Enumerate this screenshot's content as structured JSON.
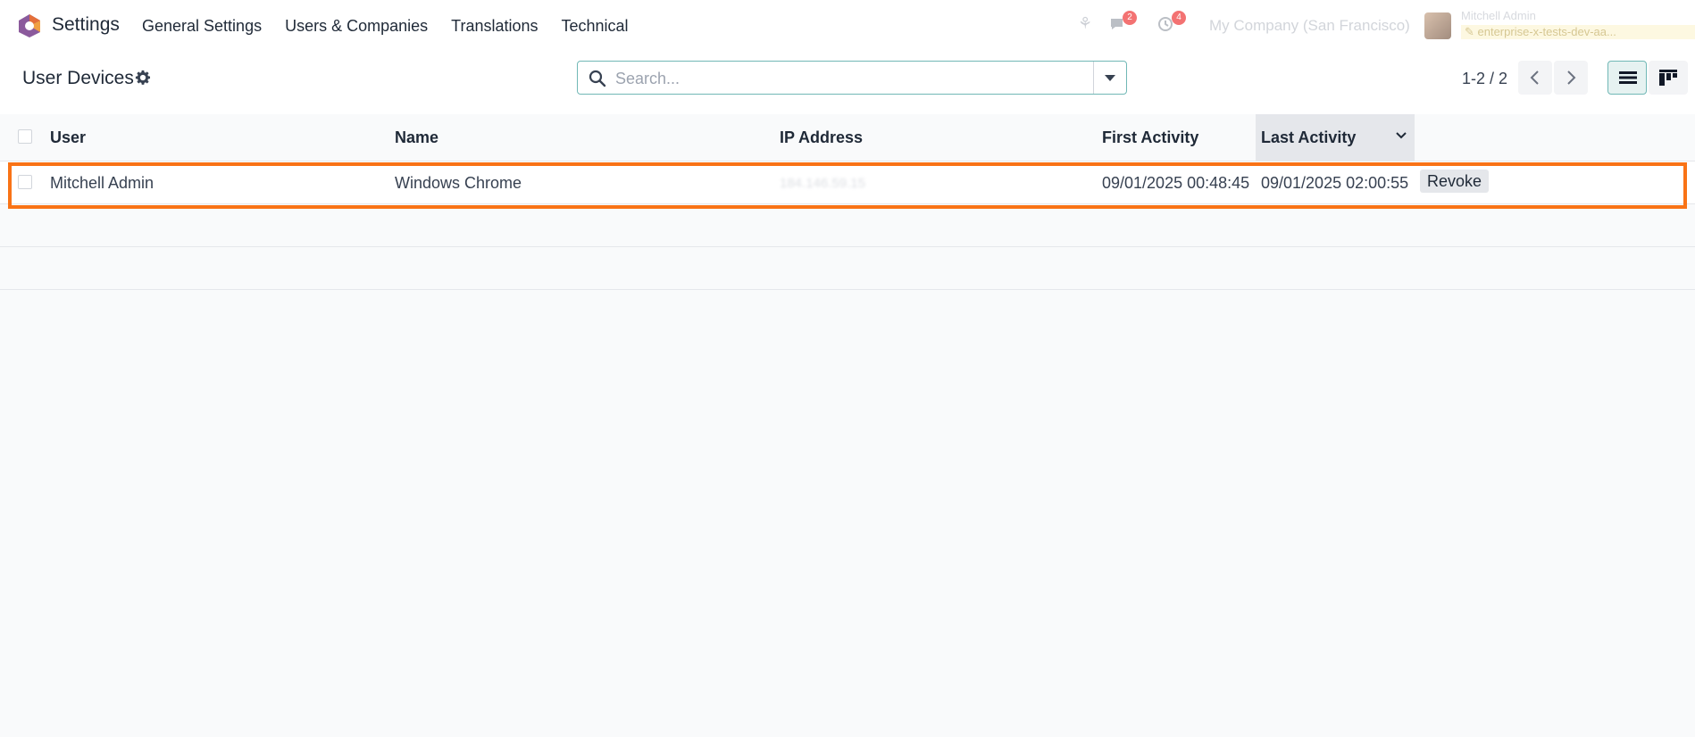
{
  "app": {
    "name": "Settings"
  },
  "menu": [
    "General Settings",
    "Users & Companies",
    "Translations",
    "Technical"
  ],
  "systray": {
    "messages_badge": "2",
    "activity_badge": "4",
    "company": "My Company (San Francisco)",
    "user_name": "Mitchell Admin",
    "database": "✎ enterprise-x-tests-dev-aa..."
  },
  "breadcrumb": {
    "title": "User Devices"
  },
  "search": {
    "placeholder": "Search..."
  },
  "pager": {
    "value": "1-2 / 2"
  },
  "table": {
    "columns": [
      "User",
      "Name",
      "IP Address",
      "First Activity",
      "Last Activity"
    ],
    "sorted_column": "Last Activity",
    "rows": [
      {
        "user": "Mitchell Admin",
        "name": "Windows Chrome",
        "ip": "184.146.59.15",
        "first_activity": "09/01/2025 00:48:45",
        "last_activity": "09/01/2025 02:00:55",
        "action": "Revoke"
      }
    ]
  },
  "colors": {
    "accent": "#71b8b6",
    "highlight": "#f97316",
    "brand": "#e46f3a"
  }
}
